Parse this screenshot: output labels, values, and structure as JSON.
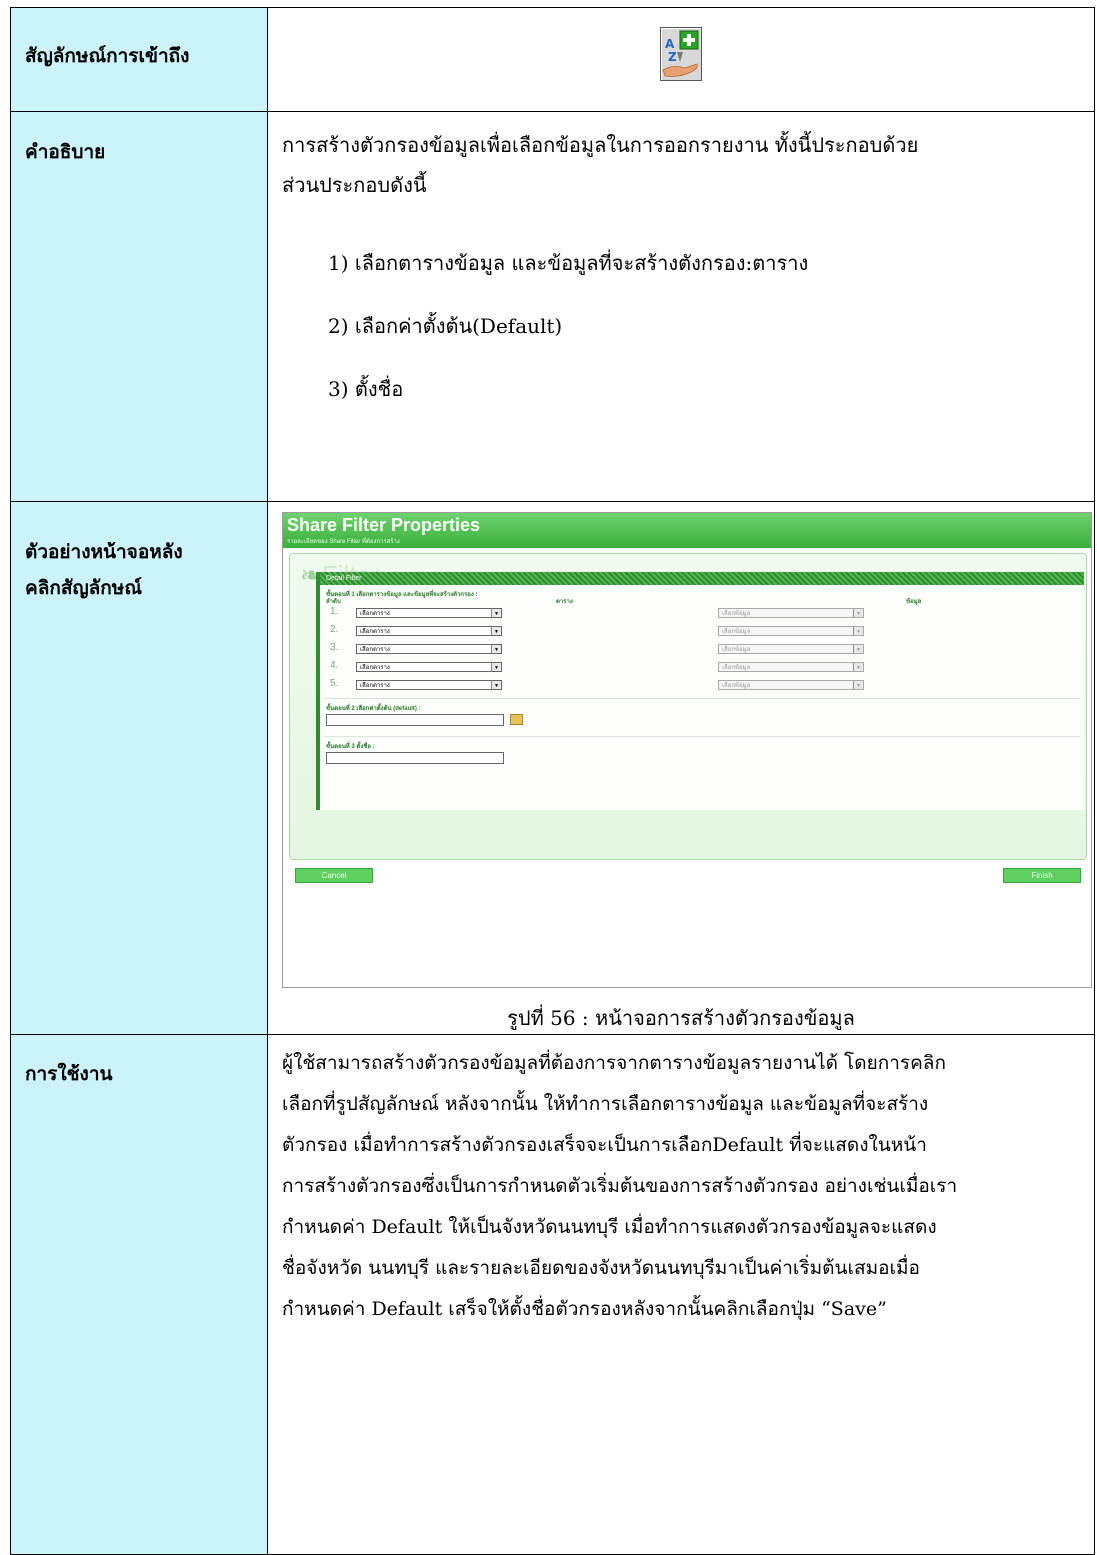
{
  "rows": [
    {
      "label_lines": [
        "สัญลักษณ์การเข้าถึง"
      ]
    },
    {
      "label_lines": [
        "คำอธิบาย"
      ]
    },
    {
      "label_lines": [
        "ตัวอย่างหน้าจอหลัง",
        "คลิกสัญลักษณ์"
      ]
    },
    {
      "label_lines": [
        "การใช้งาน"
      ]
    }
  ],
  "icon": {
    "name": "az-add-filter-icon",
    "colors": {
      "plus": "#2aa52a",
      "hand": "#e8a070"
    }
  },
  "description": {
    "lines": [
      "การสร้างตัวกรองข้อมูลเพื่อเลือกข้อมูลในการออกรายงาน ทั้งนี้ประกอบด้วย",
      "ส่วนประกอบดังนี้"
    ],
    "items": [
      "1)  เลือกตารางข้อมูล และข้อมูลที่จะสร้างตังกรอง:ตาราง",
      "2)  เลือกค่าตั้งต้น(Default)",
      "3)  ตั้งชื่อ"
    ]
  },
  "screenshot": {
    "title": "Share Filter Properties",
    "subtitle": "รายละเอียดของ Share Filter ที่ต้องการสร้าง",
    "logo": "Filter",
    "section": "Detail Filter",
    "step1": "ขั้นตอนที่ 1 เลือกตารางข้อมูล และข้อมูลที่จะสร้างตัวกรอง :",
    "col_order": "ลำดับ",
    "col_table": "ตาราง",
    "col_data": "ข้อมูล",
    "rows": [
      {
        "n": "1.",
        "table": "เลือกตาราง",
        "data": "เลือกข้อมูล"
      },
      {
        "n": "2.",
        "table": "เลือกตาราง",
        "data": "เลือกข้อมูล"
      },
      {
        "n": "3.",
        "table": "เลือกตาราง",
        "data": "เลือกข้อมูล"
      },
      {
        "n": "4.",
        "table": "เลือกตาราง",
        "data": "เลือกข้อมูล"
      },
      {
        "n": "5.",
        "table": "เลือกตาราง",
        "data": "เลือกข้อมูล"
      }
    ],
    "step2": "ขั้นตอนที่ 2 เลือกค่าตั้งต้น (default) :",
    "step3": "ขั้นตอนที่ 3 ตั้งชื่อ :",
    "cancel": "Cancel",
    "finish": "Finish"
  },
  "caption": "รูปที่ 56 : หน้าจอการสร้างตัวกรองข้อมูล",
  "usage": {
    "lines": [
      "ผู้ใช้สามารถสร้างตัวกรองข้อมูลที่ต้องการจากตารางข้อมูลรายงานได้   โดยการคลิก",
      "เลือกที่รูปสัญลักษณ์  หลังจากนั้น  ให้ทำการเลือกตารางข้อมูล  และข้อมูลที่จะสร้าง",
      "ตัวกรอง  เมื่อทำการสร้างตัวกรองเสร็จจะเป็นการเลือกDefault  ที่จะแสดงในหน้า",
      "การสร้างตัวกรองซึ่งเป็นการกำหนดตัวเริ่มต้นของการสร้างตัวกรอง อย่างเช่นเมื่อเรา",
      "กำหนดค่า Default ให้เป็นจังหวัดนนทบุรี เมื่อทำการแสดงตัวกรองข้อมูลจะแสดง",
      "ชื่อจังหวัด   นนทบุรี   และรายละเอียดของจังหวัดนนทบุรีมาเป็นค่าเริ่มต้นเสมอเมื่อ",
      "กำหนดค่า Default เสร็จให้ตั้งชื่อตัวกรองหลังจากนั้นคลิกเลือกปุ่ม “Save”"
    ]
  }
}
